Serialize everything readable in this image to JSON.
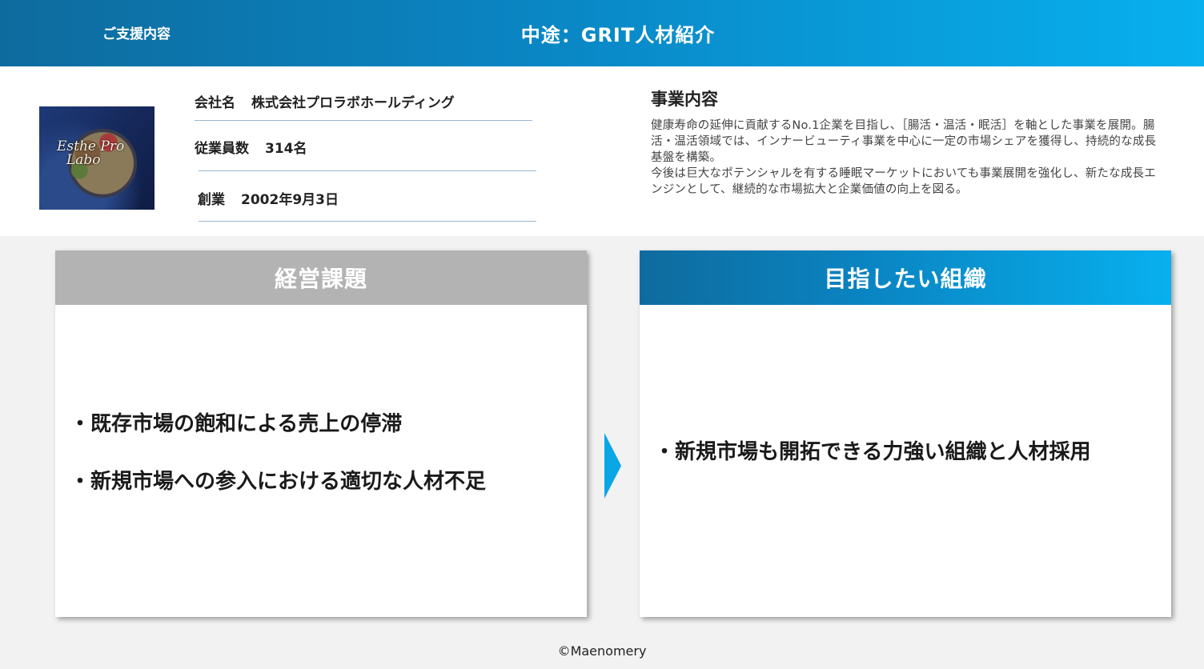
{
  "header": {
    "tag": "ご支援内容",
    "title": "中途：GRIT人材紹介"
  },
  "company": {
    "logo_text_line1": "Esthe Pro",
    "logo_text_line2": "Labo",
    "name_label": "会社名",
    "name_value": "株式会社プロラボホールディング",
    "employees_label": "従業員数",
    "employees_value": "314名",
    "founded_label": "創業",
    "founded_value": "2002年9月3日"
  },
  "business": {
    "title": "事業内容",
    "paragraph1": "健康寿命の延伸に貢献するNo.1企業を目指し、［腸活・温活・眠活］を軸とした事業を展開。腸活・温活領域では、インナービューティ事業を中心に一定の市場シェアを獲得し、持続的な成長基盤を構築。",
    "paragraph2": "今後は巨大なポテンシャルを有する睡眠マーケットにおいても事業展開を強化し、新たな成長エンジンとして、継続的な市場拡大と企業価値の向上を図る。"
  },
  "issues": {
    "title": "経営課題",
    "items": [
      "・既存市場の飽和による売上の停滞",
      "・新規市場への参入における適切な人材不足"
    ]
  },
  "goal": {
    "title": "目指したい組織",
    "items": [
      "・新規市場も開拓できる力強い組織と人材採用"
    ]
  },
  "colors": {
    "accent_dark": "#0e6b9e",
    "accent_light": "#08b0ee",
    "issues_header": "#b3b3b3"
  },
  "footer": {
    "copyright": "©Maenomery"
  }
}
